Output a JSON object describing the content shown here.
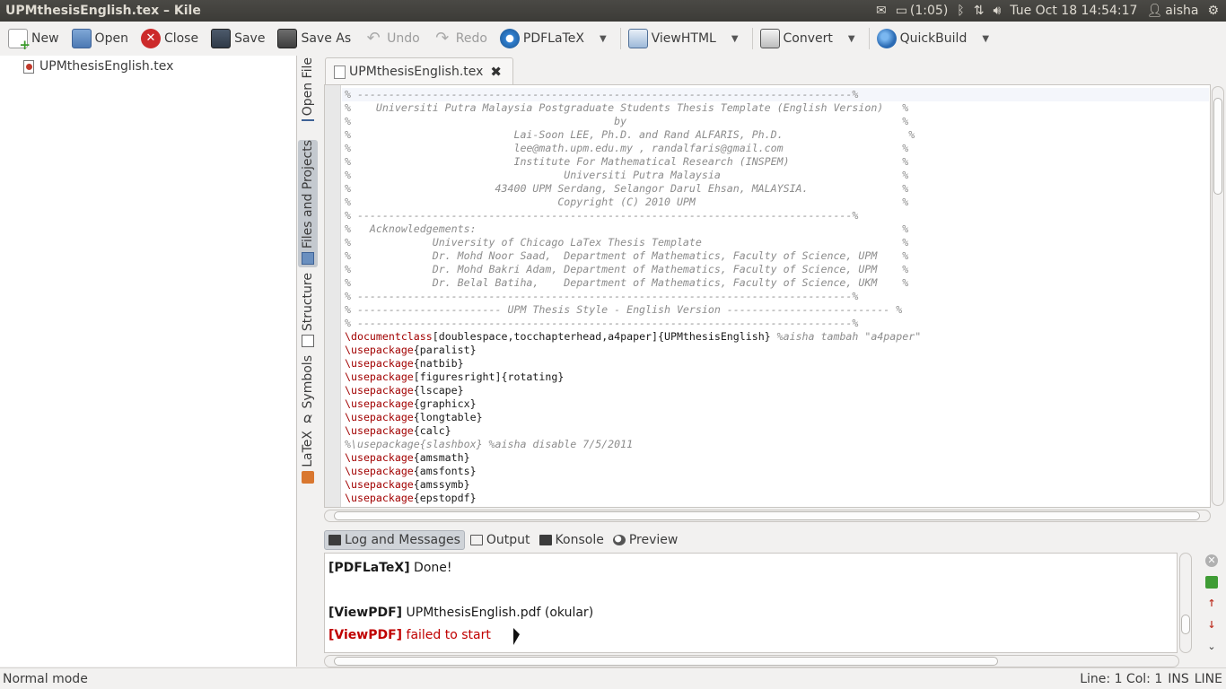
{
  "window": {
    "title": "UPMthesisEnglish.tex – Kile"
  },
  "tray": {
    "battery": "(1:05)",
    "datetime": "Tue Oct 18 14:54:17",
    "user": "aisha"
  },
  "toolbar": {
    "new": "New",
    "open": "Open",
    "close": "Close",
    "save": "Save",
    "save_as": "Save As",
    "undo": "Undo",
    "redo": "Redo",
    "pdflatex": "PDFLaTeX",
    "viewhtml": "ViewHTML",
    "convert": "Convert",
    "quickbuild": "QuickBuild"
  },
  "file_tree": {
    "items": [
      {
        "label": "UPMthesisEnglish.tex"
      }
    ]
  },
  "side_tabs": {
    "open_file": "Open File",
    "files_projects": "Files and Projects",
    "structure": "Structure",
    "symbols": "Symbols",
    "latex": "LaTeX"
  },
  "editor": {
    "tab_label": "UPMthesisEnglish.tex",
    "lines": [
      {
        "cmd": "",
        "args": "",
        "comment": "% -------------------------------------------------------------------------------%"
      },
      {
        "cmd": "",
        "args": "",
        "comment": "%    Universiti Putra Malaysia Postgraduate Students Thesis Template (English Version)   %"
      },
      {
        "cmd": "",
        "args": "",
        "comment": "%                                          by                                            %"
      },
      {
        "cmd": "",
        "args": "",
        "comment": "%                          Lai-Soon LEE, Ph.D. and Rand ALFARIS, Ph.D.                    %"
      },
      {
        "cmd": "",
        "args": "",
        "comment": "%                          lee@math.upm.edu.my , randalfaris@gmail.com                   %"
      },
      {
        "cmd": "",
        "args": "",
        "comment": "%                          Institute For Mathematical Research (INSPEM)                  %"
      },
      {
        "cmd": "",
        "args": "",
        "comment": "%                                  Universiti Putra Malaysia                             %"
      },
      {
        "cmd": "",
        "args": "",
        "comment": "%                       43400 UPM Serdang, Selangor Darul Ehsan, MALAYSIA.               %"
      },
      {
        "cmd": "",
        "args": "",
        "comment": "%                                 Copyright (C) 2010 UPM                                 %"
      },
      {
        "cmd": "",
        "args": "",
        "comment": "% -------------------------------------------------------------------------------%"
      },
      {
        "cmd": "",
        "args": "",
        "comment": "%   Acknowledgements:                                                                    %"
      },
      {
        "cmd": "",
        "args": "",
        "comment": "%             University of Chicago LaTex Thesis Template                                %"
      },
      {
        "cmd": "",
        "args": "",
        "comment": "%             Dr. Mohd Noor Saad,  Department of Mathematics, Faculty of Science, UPM    %"
      },
      {
        "cmd": "",
        "args": "",
        "comment": "%             Dr. Mohd Bakri Adam, Department of Mathematics, Faculty of Science, UPM    %"
      },
      {
        "cmd": "",
        "args": "",
        "comment": "%             Dr. Belal Batiha,    Department of Mathematics, Faculty of Science, UKM    %"
      },
      {
        "cmd": "",
        "args": "",
        "comment": "% -------------------------------------------------------------------------------%"
      },
      {
        "cmd": "",
        "args": "",
        "comment": "% ----------------------- UPM Thesis Style - English Version -------------------------- %"
      },
      {
        "cmd": "",
        "args": "",
        "comment": "% -------------------------------------------------------------------------------%"
      },
      {
        "cmd": "\\documentclass",
        "args": "[doublespace,tocchapterhead,a4paper]{UPMthesisEnglish} ",
        "comment": "%aisha tambah \"a4paper\""
      },
      {
        "cmd": "\\usepackage",
        "args": "{paralist}",
        "comment": ""
      },
      {
        "cmd": "\\usepackage",
        "args": "{natbib}",
        "comment": ""
      },
      {
        "cmd": "\\usepackage",
        "args": "[figuresright]{rotating}",
        "comment": ""
      },
      {
        "cmd": "\\usepackage",
        "args": "{lscape}",
        "comment": ""
      },
      {
        "cmd": "\\usepackage",
        "args": "{graphicx}",
        "comment": ""
      },
      {
        "cmd": "\\usepackage",
        "args": "{longtable}",
        "comment": ""
      },
      {
        "cmd": "\\usepackage",
        "args": "{calc}",
        "comment": ""
      },
      {
        "cmd": "",
        "args": "",
        "comment": "%\\usepackage{slashbox} %aisha disable 7/5/2011"
      },
      {
        "cmd": "\\usepackage",
        "args": "{amsmath}",
        "comment": ""
      },
      {
        "cmd": "\\usepackage",
        "args": "{amsfonts}",
        "comment": ""
      },
      {
        "cmd": "\\usepackage",
        "args": "{amssymb}",
        "comment": ""
      },
      {
        "cmd": "\\usepackage",
        "args": "{epstopdf}",
        "comment": ""
      }
    ]
  },
  "bottom_panel": {
    "tabs": {
      "log": "Log and Messages",
      "output": "Output",
      "konsole": "Konsole",
      "preview": "Preview"
    },
    "messages": [
      {
        "tag": "[PDFLaTeX]",
        "text": " Done!",
        "error": false
      },
      {
        "tag": "",
        "text": "",
        "error": false
      },
      {
        "tag": "[ViewPDF]",
        "text": " UPMthesisEnglish.pdf (okular)",
        "error": false
      },
      {
        "tag": "[ViewPDF]",
        "text": " failed to start",
        "error": true
      }
    ]
  },
  "status_bar": {
    "mode": "Normal mode",
    "position": "Line: 1 Col: 1",
    "ins": "INS",
    "line": "LINE"
  }
}
